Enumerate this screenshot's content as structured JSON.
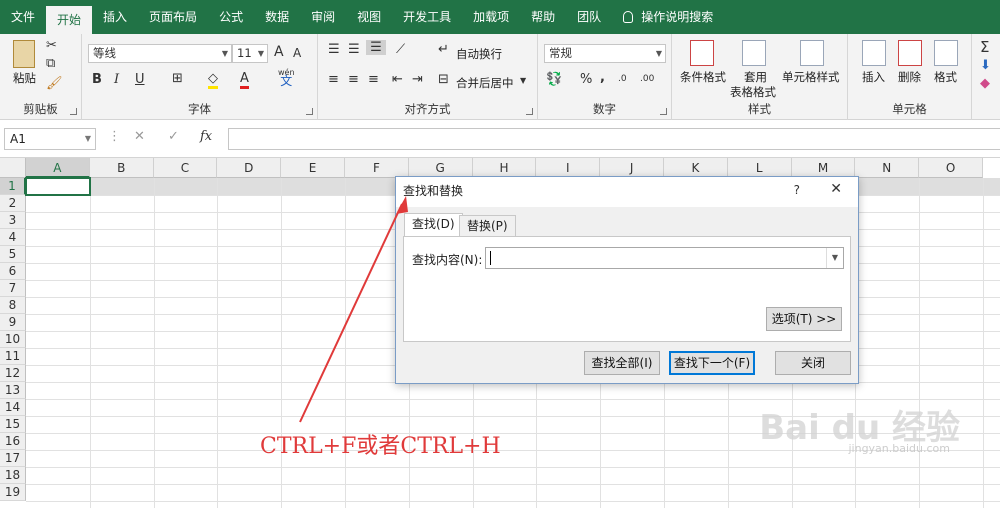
{
  "menubar": {
    "items": [
      "文件",
      "开始",
      "插入",
      "页面布局",
      "公式",
      "数据",
      "审阅",
      "视图",
      "开发工具",
      "加载项",
      "帮助",
      "团队"
    ],
    "active": "开始",
    "tell_me": "操作说明搜索"
  },
  "ribbon": {
    "clipboard": {
      "label": "剪贴板",
      "paste": "粘贴"
    },
    "font": {
      "label": "字体",
      "font_name": "等线",
      "font_size": "11",
      "bold": "B",
      "italic": "I",
      "underline": "U",
      "grow": "A",
      "shrink": "A",
      "font_color": "A",
      "wen": "wén",
      "wen_char": "文"
    },
    "alignment": {
      "label": "对齐方式",
      "wrap": "自动换行",
      "merge": "合并后居中"
    },
    "number": {
      "label": "数字",
      "format": "常规",
      "percent": "%",
      "comma": ",",
      "inc": ".0",
      "dec": ".00"
    },
    "styles": {
      "label": "样式",
      "cond": "条件格式",
      "table": "套用",
      "table2": "表格格式",
      "cell": "单元格样式"
    },
    "cells": {
      "label": "单元格",
      "insert": "插入",
      "delete": "删除",
      "format": "格式"
    },
    "editing": {
      "sum": "Σ"
    }
  },
  "formula_bar": {
    "name_box": "A1",
    "cancel": "✕",
    "enter": "✓",
    "fx": "fx",
    "value": ""
  },
  "sheet": {
    "columns": [
      "A",
      "B",
      "C",
      "D",
      "E",
      "F",
      "G",
      "H",
      "I",
      "J",
      "K",
      "L",
      "M",
      "N",
      "O"
    ],
    "rows": [
      "1",
      "2",
      "3",
      "4",
      "5",
      "6",
      "7",
      "8",
      "9",
      "10",
      "11",
      "12",
      "13",
      "14",
      "15",
      "16",
      "17",
      "18",
      "19"
    ]
  },
  "dialog": {
    "title": "查找和替换",
    "help": "?",
    "close": "✕",
    "tab_find": "查找(D)",
    "tab_replace": "替换(P)",
    "find_label": "查找内容(N):",
    "find_value": "",
    "options_btn": "选项(T) >>",
    "find_all_btn": "查找全部(I)",
    "find_next_btn": "查找下一个(F)",
    "close_btn": "关闭"
  },
  "annotation": {
    "text": "CTRL+F或者CTRL+H",
    "color": "#e03a3a"
  },
  "watermark": {
    "text": "Bai du 经验",
    "url": "jingyan.baidu.com"
  },
  "colors": {
    "accent": "#217346",
    "dialog_border": "#7a9cc6"
  }
}
